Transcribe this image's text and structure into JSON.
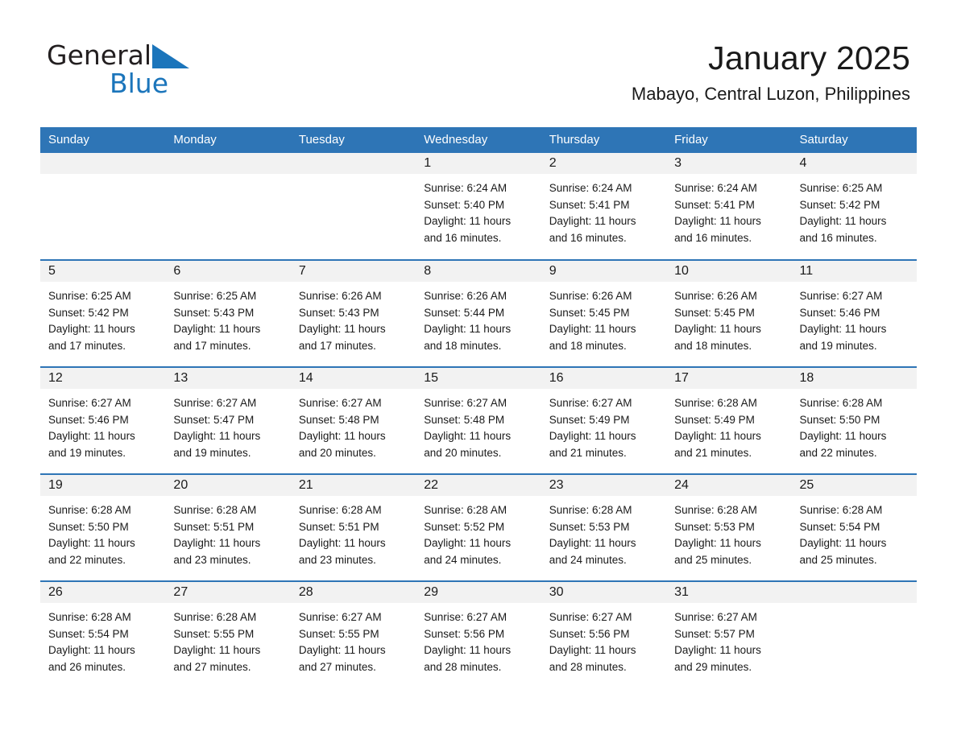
{
  "brand": {
    "name_part1": "General",
    "name_part2": "Blue",
    "triangle_color": "#1b75bb",
    "text_color": "#231f20"
  },
  "header": {
    "title": "January 2025",
    "subtitle": "Mabayo, Central Luzon, Philippines"
  },
  "theme": {
    "header_bg": "#2e75b6",
    "header_text": "#ffffff",
    "daynum_bg": "#f2f2f2",
    "row_divider": "#2e75b6",
    "page_bg": "#ffffff",
    "body_text": "#1a1a1a"
  },
  "calendar": {
    "month": "January",
    "year": "2025",
    "weekday_headers": [
      "Sunday",
      "Monday",
      "Tuesday",
      "Wednesday",
      "Thursday",
      "Friday",
      "Saturday"
    ],
    "weeks": [
      [
        {
          "day": "",
          "empty": true,
          "sunrise": "",
          "sunset": "",
          "daylight_line1": "",
          "daylight_line2": ""
        },
        {
          "day": "",
          "empty": true,
          "sunrise": "",
          "sunset": "",
          "daylight_line1": "",
          "daylight_line2": ""
        },
        {
          "day": "",
          "empty": true,
          "sunrise": "",
          "sunset": "",
          "daylight_line1": "",
          "daylight_line2": ""
        },
        {
          "day": "1",
          "empty": false,
          "sunrise": "Sunrise: 6:24 AM",
          "sunset": "Sunset: 5:40 PM",
          "daylight_line1": "Daylight: 11 hours",
          "daylight_line2": "and 16 minutes."
        },
        {
          "day": "2",
          "empty": false,
          "sunrise": "Sunrise: 6:24 AM",
          "sunset": "Sunset: 5:41 PM",
          "daylight_line1": "Daylight: 11 hours",
          "daylight_line2": "and 16 minutes."
        },
        {
          "day": "3",
          "empty": false,
          "sunrise": "Sunrise: 6:24 AM",
          "sunset": "Sunset: 5:41 PM",
          "daylight_line1": "Daylight: 11 hours",
          "daylight_line2": "and 16 minutes."
        },
        {
          "day": "4",
          "empty": false,
          "sunrise": "Sunrise: 6:25 AM",
          "sunset": "Sunset: 5:42 PM",
          "daylight_line1": "Daylight: 11 hours",
          "daylight_line2": "and 16 minutes."
        }
      ],
      [
        {
          "day": "5",
          "empty": false,
          "sunrise": "Sunrise: 6:25 AM",
          "sunset": "Sunset: 5:42 PM",
          "daylight_line1": "Daylight: 11 hours",
          "daylight_line2": "and 17 minutes."
        },
        {
          "day": "6",
          "empty": false,
          "sunrise": "Sunrise: 6:25 AM",
          "sunset": "Sunset: 5:43 PM",
          "daylight_line1": "Daylight: 11 hours",
          "daylight_line2": "and 17 minutes."
        },
        {
          "day": "7",
          "empty": false,
          "sunrise": "Sunrise: 6:26 AM",
          "sunset": "Sunset: 5:43 PM",
          "daylight_line1": "Daylight: 11 hours",
          "daylight_line2": "and 17 minutes."
        },
        {
          "day": "8",
          "empty": false,
          "sunrise": "Sunrise: 6:26 AM",
          "sunset": "Sunset: 5:44 PM",
          "daylight_line1": "Daylight: 11 hours",
          "daylight_line2": "and 18 minutes."
        },
        {
          "day": "9",
          "empty": false,
          "sunrise": "Sunrise: 6:26 AM",
          "sunset": "Sunset: 5:45 PM",
          "daylight_line1": "Daylight: 11 hours",
          "daylight_line2": "and 18 minutes."
        },
        {
          "day": "10",
          "empty": false,
          "sunrise": "Sunrise: 6:26 AM",
          "sunset": "Sunset: 5:45 PM",
          "daylight_line1": "Daylight: 11 hours",
          "daylight_line2": "and 18 minutes."
        },
        {
          "day": "11",
          "empty": false,
          "sunrise": "Sunrise: 6:27 AM",
          "sunset": "Sunset: 5:46 PM",
          "daylight_line1": "Daylight: 11 hours",
          "daylight_line2": "and 19 minutes."
        }
      ],
      [
        {
          "day": "12",
          "empty": false,
          "sunrise": "Sunrise: 6:27 AM",
          "sunset": "Sunset: 5:46 PM",
          "daylight_line1": "Daylight: 11 hours",
          "daylight_line2": "and 19 minutes."
        },
        {
          "day": "13",
          "empty": false,
          "sunrise": "Sunrise: 6:27 AM",
          "sunset": "Sunset: 5:47 PM",
          "daylight_line1": "Daylight: 11 hours",
          "daylight_line2": "and 19 minutes."
        },
        {
          "day": "14",
          "empty": false,
          "sunrise": "Sunrise: 6:27 AM",
          "sunset": "Sunset: 5:48 PM",
          "daylight_line1": "Daylight: 11 hours",
          "daylight_line2": "and 20 minutes."
        },
        {
          "day": "15",
          "empty": false,
          "sunrise": "Sunrise: 6:27 AM",
          "sunset": "Sunset: 5:48 PM",
          "daylight_line1": "Daylight: 11 hours",
          "daylight_line2": "and 20 minutes."
        },
        {
          "day": "16",
          "empty": false,
          "sunrise": "Sunrise: 6:27 AM",
          "sunset": "Sunset: 5:49 PM",
          "daylight_line1": "Daylight: 11 hours",
          "daylight_line2": "and 21 minutes."
        },
        {
          "day": "17",
          "empty": false,
          "sunrise": "Sunrise: 6:28 AM",
          "sunset": "Sunset: 5:49 PM",
          "daylight_line1": "Daylight: 11 hours",
          "daylight_line2": "and 21 minutes."
        },
        {
          "day": "18",
          "empty": false,
          "sunrise": "Sunrise: 6:28 AM",
          "sunset": "Sunset: 5:50 PM",
          "daylight_line1": "Daylight: 11 hours",
          "daylight_line2": "and 22 minutes."
        }
      ],
      [
        {
          "day": "19",
          "empty": false,
          "sunrise": "Sunrise: 6:28 AM",
          "sunset": "Sunset: 5:50 PM",
          "daylight_line1": "Daylight: 11 hours",
          "daylight_line2": "and 22 minutes."
        },
        {
          "day": "20",
          "empty": false,
          "sunrise": "Sunrise: 6:28 AM",
          "sunset": "Sunset: 5:51 PM",
          "daylight_line1": "Daylight: 11 hours",
          "daylight_line2": "and 23 minutes."
        },
        {
          "day": "21",
          "empty": false,
          "sunrise": "Sunrise: 6:28 AM",
          "sunset": "Sunset: 5:51 PM",
          "daylight_line1": "Daylight: 11 hours",
          "daylight_line2": "and 23 minutes."
        },
        {
          "day": "22",
          "empty": false,
          "sunrise": "Sunrise: 6:28 AM",
          "sunset": "Sunset: 5:52 PM",
          "daylight_line1": "Daylight: 11 hours",
          "daylight_line2": "and 24 minutes."
        },
        {
          "day": "23",
          "empty": false,
          "sunrise": "Sunrise: 6:28 AM",
          "sunset": "Sunset: 5:53 PM",
          "daylight_line1": "Daylight: 11 hours",
          "daylight_line2": "and 24 minutes."
        },
        {
          "day": "24",
          "empty": false,
          "sunrise": "Sunrise: 6:28 AM",
          "sunset": "Sunset: 5:53 PM",
          "daylight_line1": "Daylight: 11 hours",
          "daylight_line2": "and 25 minutes."
        },
        {
          "day": "25",
          "empty": false,
          "sunrise": "Sunrise: 6:28 AM",
          "sunset": "Sunset: 5:54 PM",
          "daylight_line1": "Daylight: 11 hours",
          "daylight_line2": "and 25 minutes."
        }
      ],
      [
        {
          "day": "26",
          "empty": false,
          "sunrise": "Sunrise: 6:28 AM",
          "sunset": "Sunset: 5:54 PM",
          "daylight_line1": "Daylight: 11 hours",
          "daylight_line2": "and 26 minutes."
        },
        {
          "day": "27",
          "empty": false,
          "sunrise": "Sunrise: 6:28 AM",
          "sunset": "Sunset: 5:55 PM",
          "daylight_line1": "Daylight: 11 hours",
          "daylight_line2": "and 27 minutes."
        },
        {
          "day": "28",
          "empty": false,
          "sunrise": "Sunrise: 6:27 AM",
          "sunset": "Sunset: 5:55 PM",
          "daylight_line1": "Daylight: 11 hours",
          "daylight_line2": "and 27 minutes."
        },
        {
          "day": "29",
          "empty": false,
          "sunrise": "Sunrise: 6:27 AM",
          "sunset": "Sunset: 5:56 PM",
          "daylight_line1": "Daylight: 11 hours",
          "daylight_line2": "and 28 minutes."
        },
        {
          "day": "30",
          "empty": false,
          "sunrise": "Sunrise: 6:27 AM",
          "sunset": "Sunset: 5:56 PM",
          "daylight_line1": "Daylight: 11 hours",
          "daylight_line2": "and 28 minutes."
        },
        {
          "day": "31",
          "empty": false,
          "sunrise": "Sunrise: 6:27 AM",
          "sunset": "Sunset: 5:57 PM",
          "daylight_line1": "Daylight: 11 hours",
          "daylight_line2": "and 29 minutes."
        },
        {
          "day": "",
          "empty": true,
          "sunrise": "",
          "sunset": "",
          "daylight_line1": "",
          "daylight_line2": ""
        }
      ]
    ]
  }
}
